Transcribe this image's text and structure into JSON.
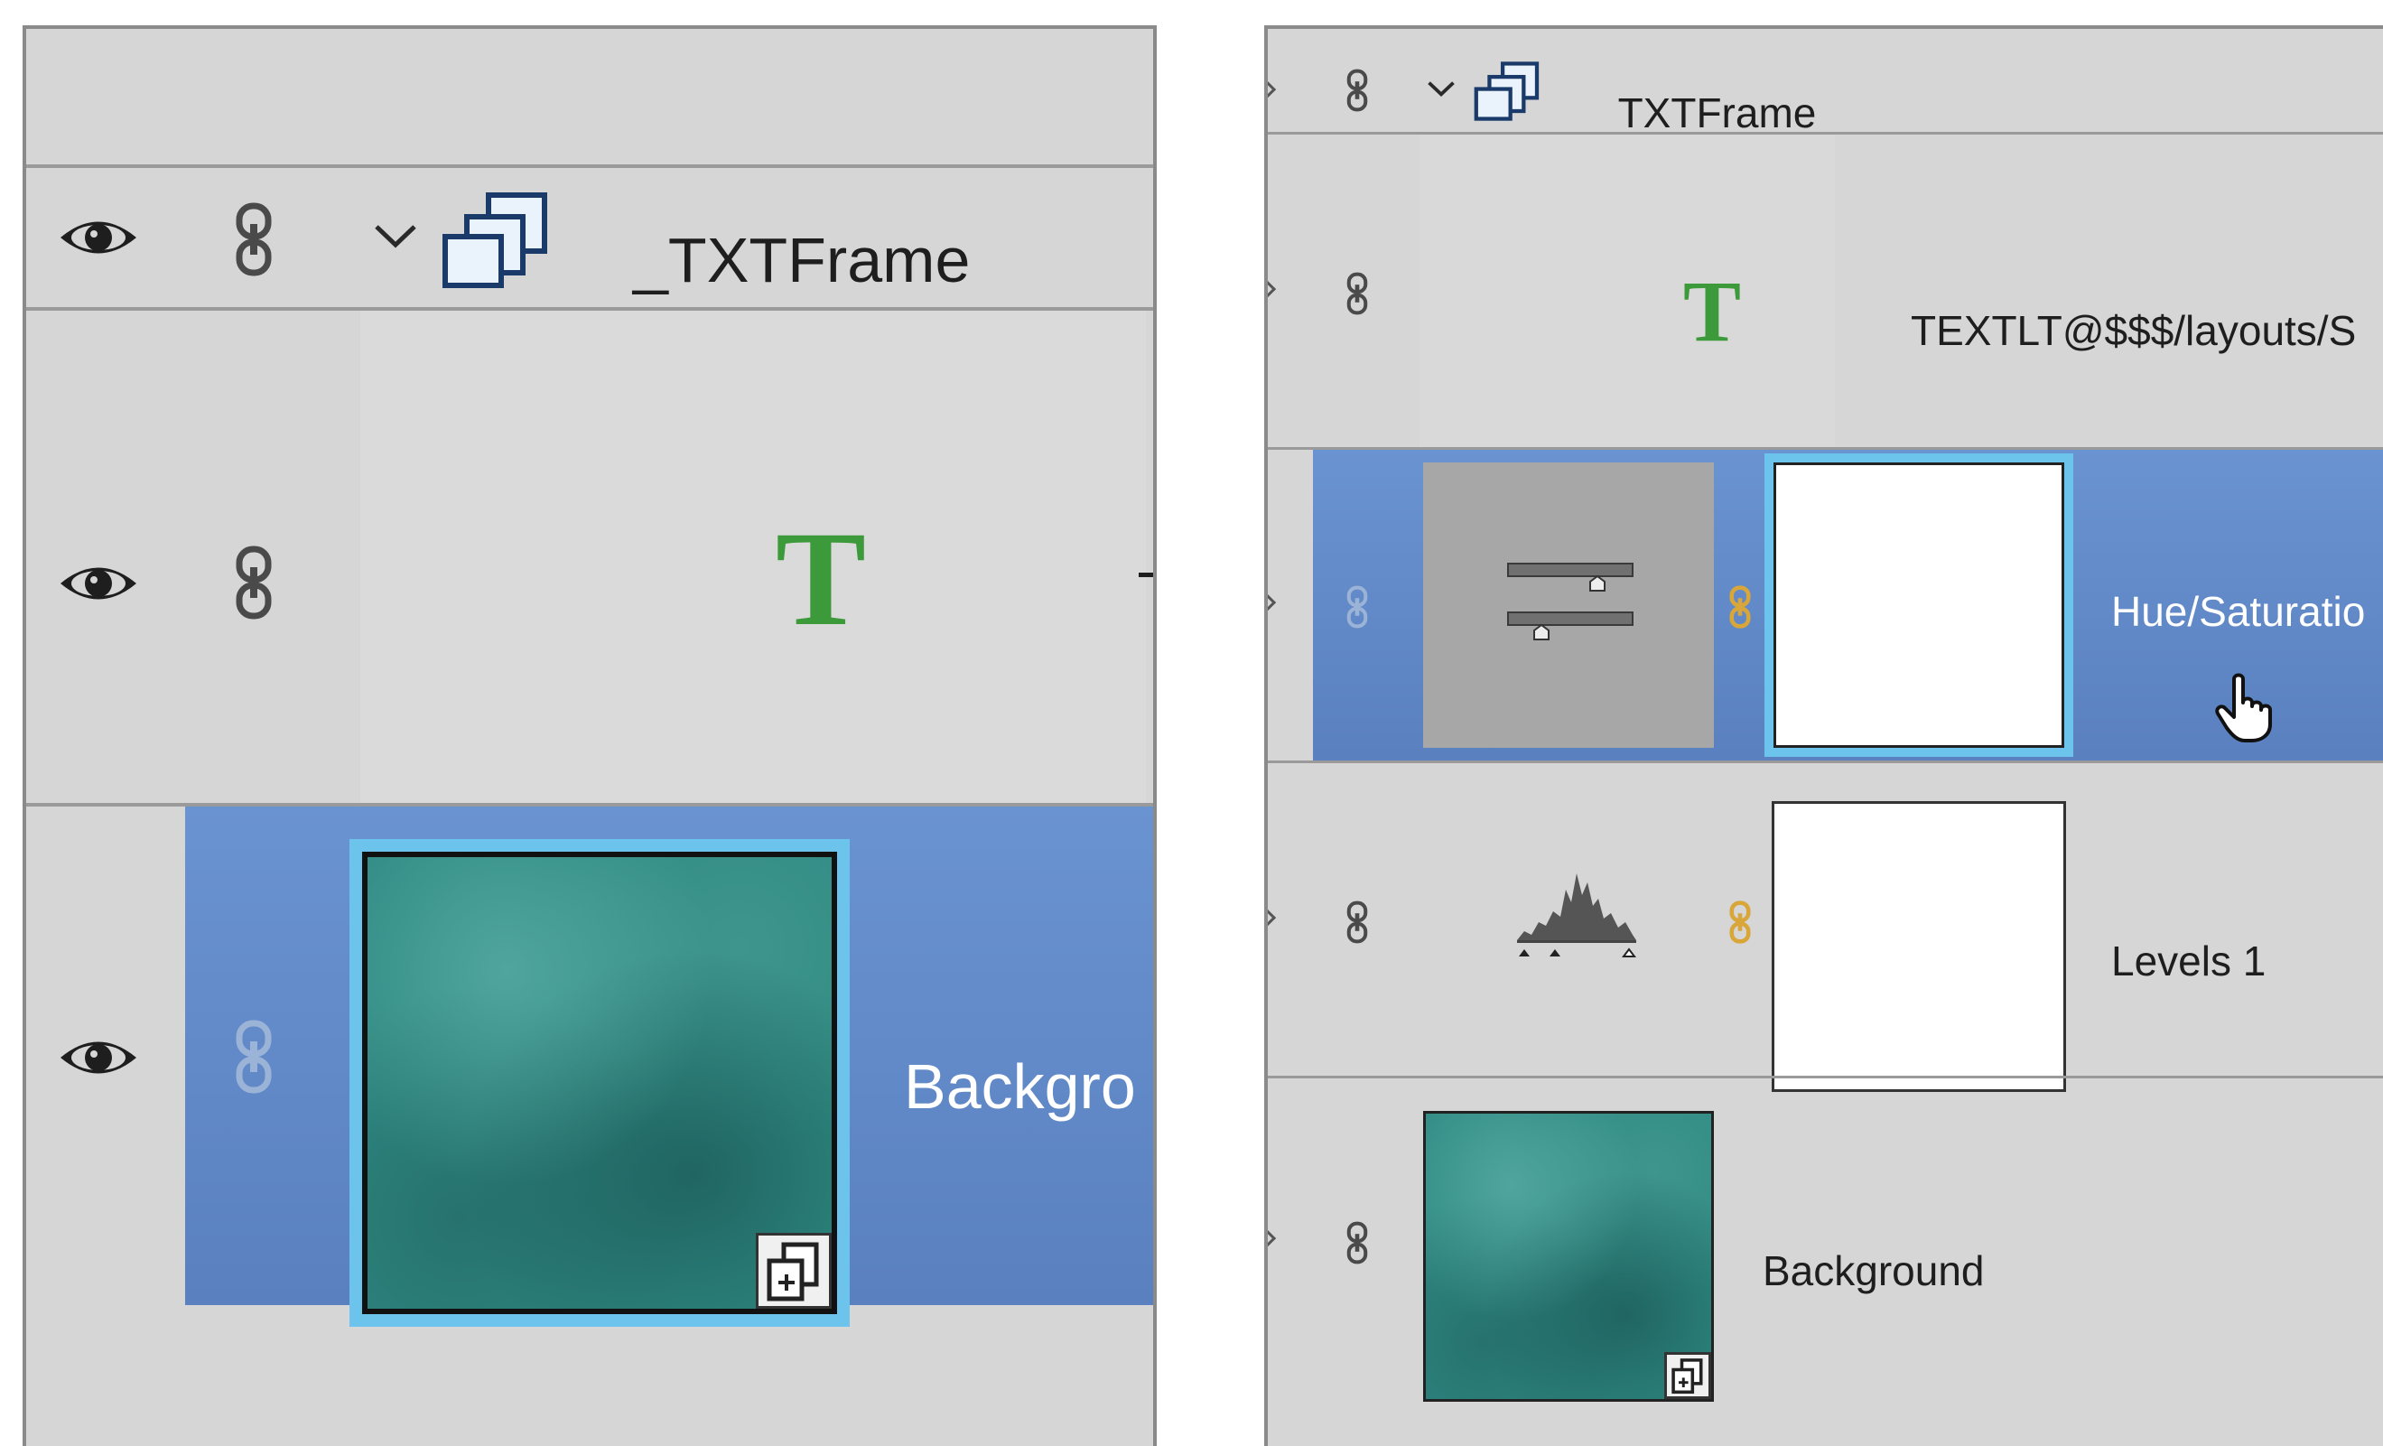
{
  "left_panel": {
    "group_row": {
      "name": "_TXTFrame"
    },
    "text_row": {
      "glyph": "T"
    },
    "background_row": {
      "name": "Backgro"
    }
  },
  "right_panel": {
    "group_row": {
      "name": "_TXTFrame"
    },
    "text_row": {
      "glyph": "T",
      "name": "TEXTLT@$$$/layouts/S"
    },
    "hue_row": {
      "name": "Hue/Saturatio"
    },
    "levels_row": {
      "name": "Levels 1"
    },
    "background_row": {
      "name": "Background"
    }
  },
  "colors": {
    "panel_bg": "#d6d6d6",
    "selected_bg": "#6a93d1",
    "text_layer_green": "#3d9a3a",
    "teal_texture": "#2f8a83",
    "link_gold": "#d9a63a"
  },
  "icons": [
    "eye-icon",
    "link-icon",
    "chevron-down-icon",
    "group-folder-icon",
    "text-layer-icon",
    "smart-object-badge-icon",
    "hue-saturation-adjustment-icon",
    "levels-histogram-icon",
    "mask-link-icon",
    "hand-cursor-icon"
  ]
}
